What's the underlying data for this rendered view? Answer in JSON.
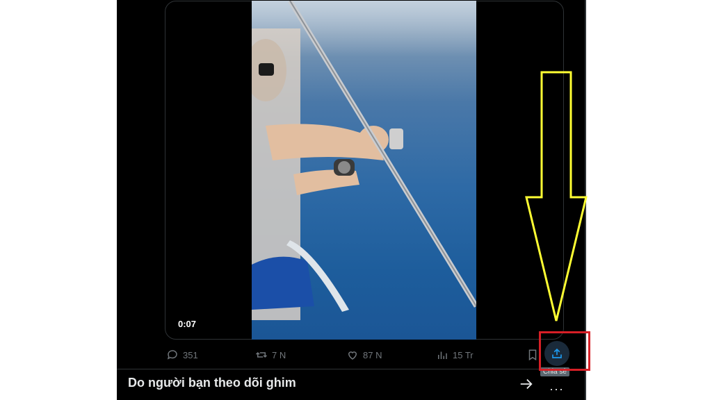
{
  "video": {
    "timestamp": "0:07"
  },
  "actions": {
    "reply": {
      "icon": "reply-icon",
      "count": "351"
    },
    "repost": {
      "icon": "repost-icon",
      "count": "7 N"
    },
    "like": {
      "icon": "heart-icon",
      "count": "87 N"
    },
    "views": {
      "icon": "views-chart-icon",
      "count": "15 Tr"
    },
    "bookmark": {
      "icon": "bookmark-icon"
    },
    "share": {
      "icon": "share-upload-icon",
      "tooltip": "Chia sẻ"
    }
  },
  "pinned": {
    "title": "Do người bạn theo dõi ghim",
    "arrow_icon": "arrow-right-icon",
    "more_icon": "more-dots-icon"
  },
  "colors": {
    "background": "#000000",
    "muted": "#71767b",
    "accent": "#1d9bf0",
    "highlight_box": "#d71f26",
    "annotation_arrow": "#ffff33"
  }
}
